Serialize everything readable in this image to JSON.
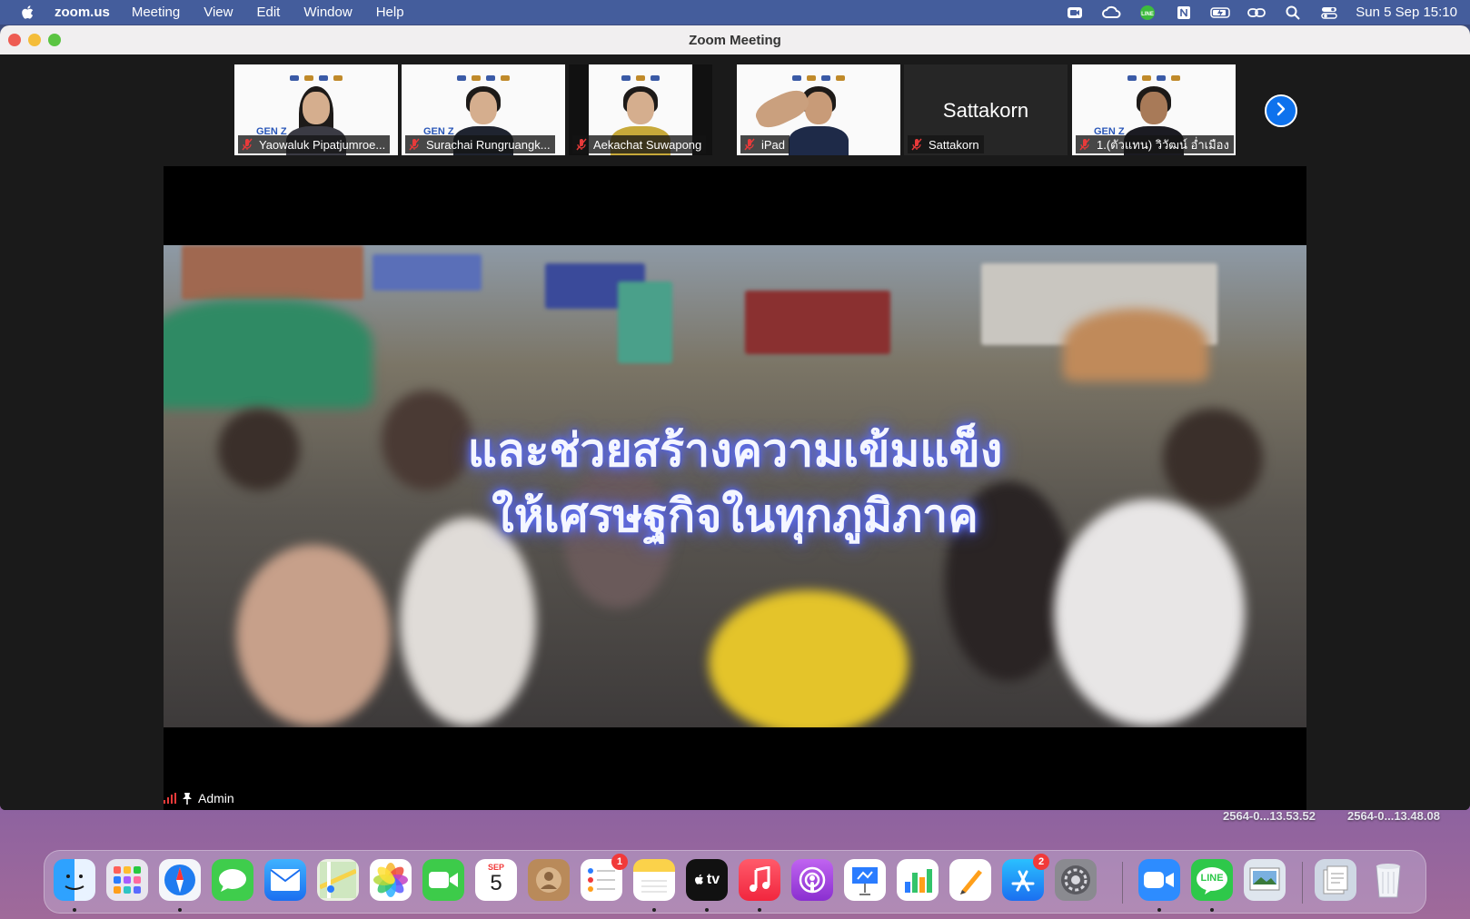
{
  "menubar": {
    "app_name": "zoom.us",
    "menus": [
      "Meeting",
      "View",
      "Edit",
      "Window",
      "Help"
    ],
    "clock": "Sun 5 Sep  15:10",
    "status_icons": [
      "zoom-icon",
      "creative-cloud-icon",
      "line-icon",
      "notion-icon",
      "battery-icon",
      "link-icon",
      "search-icon",
      "control-center-icon"
    ]
  },
  "window": {
    "title": "Zoom Meeting"
  },
  "participants": [
    {
      "name": "Yaowaluk Pipatjumroe..."
    },
    {
      "name": "Surachai Rungruangk..."
    },
    {
      "name": "Aekachat Suwapong"
    },
    {
      "name": "iPad"
    },
    {
      "name": "Sattakorn",
      "big_name": "Sattakorn"
    },
    {
      "name": "1.(ตัวแทน) วิวัฒน์ อ่ำเมือง"
    }
  ],
  "thumb_brand": "GEN Z",
  "share": {
    "text_line1": "และช่วยสร้างความเข้มแข็ง",
    "text_line2": "ให้เศรษฐกิจในทุกภูมิภาค",
    "presenter": "Admin"
  },
  "desktop_files": [
    "2564-0...13.53.52",
    "2564-0...13.48.08"
  ],
  "dock": {
    "calendar_month": "SEP",
    "calendar_day": "5",
    "tv_label": "tv",
    "line_label": "LINE",
    "reminders_badge": "1",
    "appstore_badge": "2",
    "apps": [
      "finder",
      "launchpad",
      "safari",
      "messages",
      "mail",
      "maps",
      "photos",
      "facetime",
      "calendar",
      "contacts",
      "reminders",
      "notes",
      "apple-tv",
      "music",
      "podcasts",
      "keynote",
      "numbers",
      "pages",
      "app-store",
      "system-preferences",
      "zoom",
      "line",
      "preview",
      "documents",
      "trash"
    ]
  },
  "colors": {
    "zoom_blue": "#0e72ed",
    "mic_muted": "#e83a3a",
    "glow": "#6a7cff"
  }
}
